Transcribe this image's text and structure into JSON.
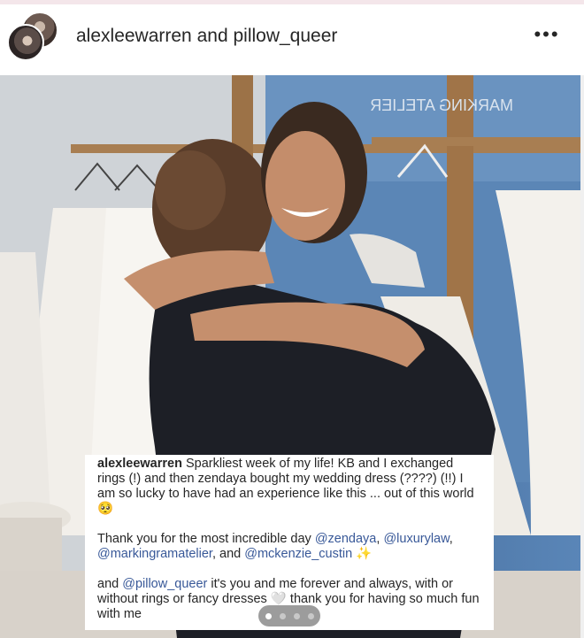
{
  "header": {
    "user1": "alexleewarren",
    "conjunction": "and",
    "user2": "pillow_queer",
    "more": "•••"
  },
  "photo": {
    "store_sign": "MARKING ATELIER"
  },
  "caption": {
    "username": "alexleewarren",
    "para1": "Sparkliest week of my life! KB and I exchanged rings (!) and then zendaya bought my wedding dress (????) (!!) I am so lucky to have had an experience like this ... out of this world 🥺",
    "para2_prefix": "Thank you for the most incredible day ",
    "mention_zendaya": "@zendaya",
    "sep1": ", ",
    "mention_luxurylaw": "@luxurylaw",
    "sep2": ", ",
    "mention_marking": "@markingramatelier",
    "sep3": ", and ",
    "mention_mckenzie": "@mckenzie_custin",
    "sparkles": " ✨",
    "para3_prefix": "and ",
    "mention_pillow": "@pillow_queer",
    "para3_rest": " it's you and me forever and always, with or without rings or fancy dresses 🤍 thank you for having so much fun with me"
  },
  "carousel": {
    "count": 4,
    "active_index": 0
  },
  "colors": {
    "mention": "#385898",
    "text": "#262626"
  }
}
